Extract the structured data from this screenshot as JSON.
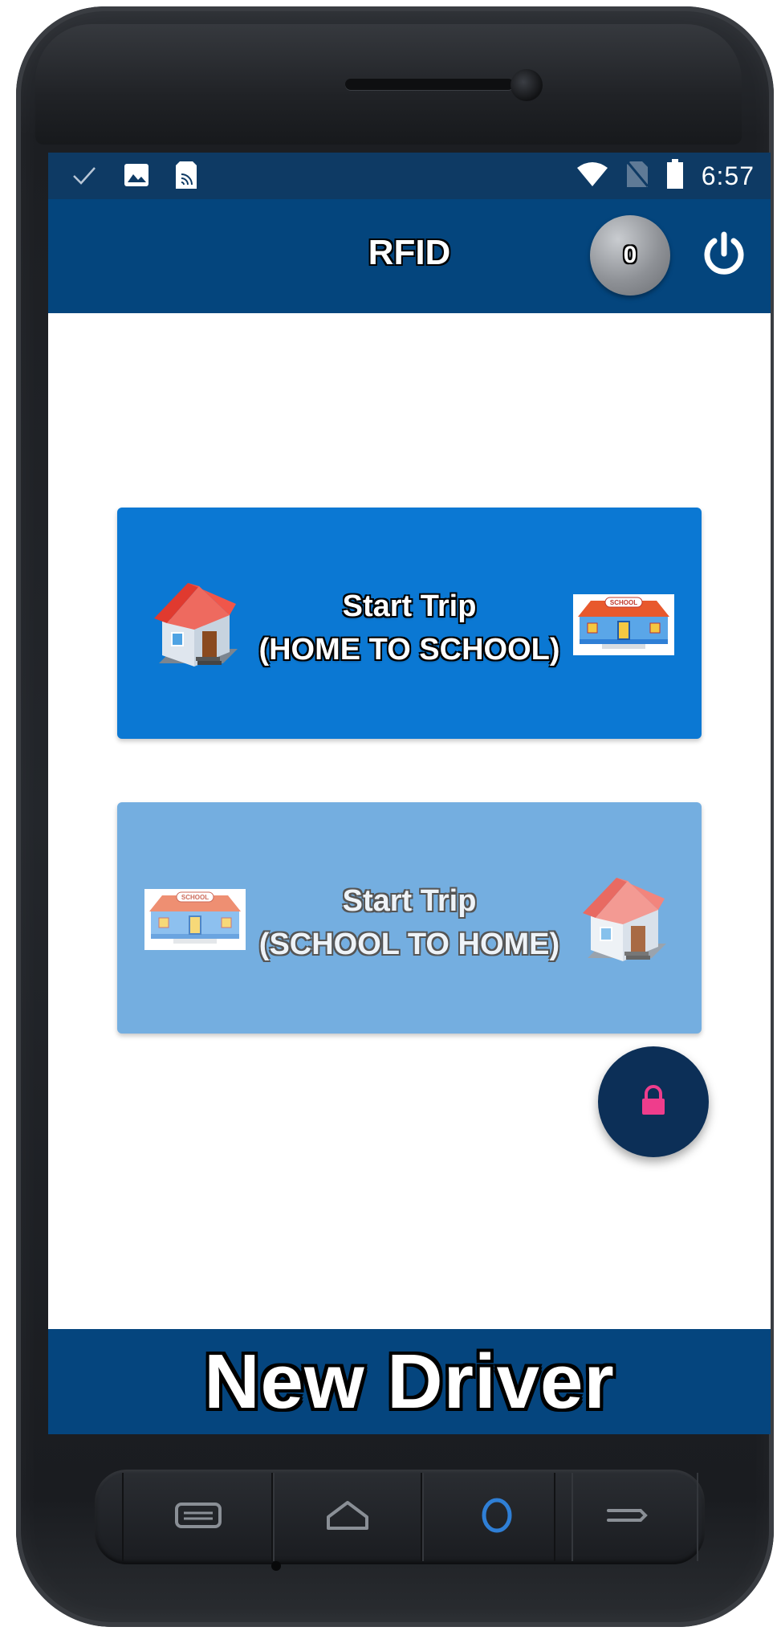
{
  "statusbar": {
    "left_icons": [
      "check-icon",
      "image-icon",
      "nfc-card-icon"
    ],
    "right_icons": [
      "wifi-icon",
      "no-sim-icon",
      "battery-icon"
    ],
    "time": "6:57"
  },
  "appbar": {
    "title": "RFID",
    "count": "0",
    "power_icon": "power-icon"
  },
  "trips": [
    {
      "line1": "Start Trip",
      "line2": "(HOME TO SCHOOL)",
      "enabled": true,
      "color": "#0b78d3"
    },
    {
      "line1": "Start Trip",
      "line2": "(SCHOOL TO HOME)",
      "enabled": false,
      "color": "#74aee0"
    }
  ],
  "fab": {
    "icon": "lock-icon",
    "icon_color": "#ef3d8c"
  },
  "banner": {
    "text": "New Driver"
  },
  "hardware_keys": [
    "menu-key-icon",
    "home-key-icon",
    "circle-key-icon",
    "back-key-icon"
  ],
  "colors": {
    "appbar": "#04457d",
    "statusbar": "#0e3a64",
    "banner": "#05457e",
    "fab_bg": "#0c2f57",
    "home_key_accent": "#2f7fd6"
  }
}
